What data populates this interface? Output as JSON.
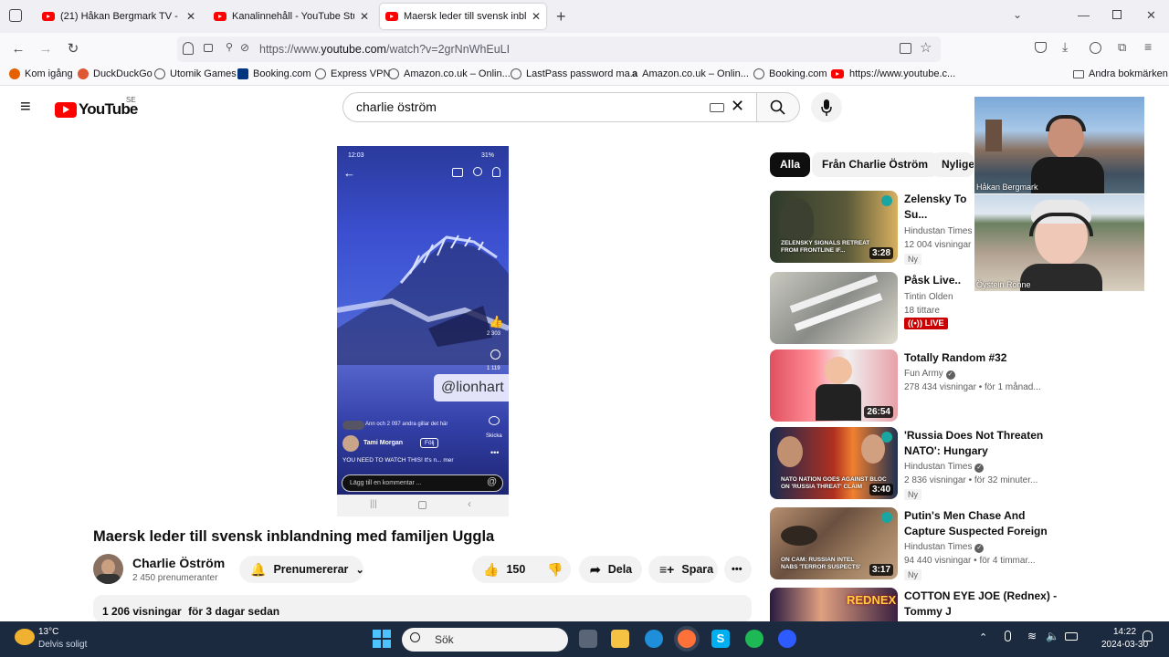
{
  "browser": {
    "tabs": [
      {
        "label": "(21) Håkan Bergmark TV - YouTu",
        "active": false
      },
      {
        "label": "Kanalinnehåll - YouTube Studio",
        "active": false
      },
      {
        "label": "Maersk leder till svensk inblandn",
        "active": true
      }
    ],
    "url_prefix": "https://www.",
    "url_domain": "youtube.com",
    "url_suffix": "/watch?v=2grNnWhEuLI",
    "bookmarks": [
      "Kom igång",
      "DuckDuckGo",
      "Utomik Games",
      "Booking.com",
      "Express VPN",
      "Amazon.co.uk – Onlin...",
      "LastPass password ma...",
      "Amazon.co.uk – Onlin...",
      "Booking.com",
      "https://www.youtube.c..."
    ],
    "other_bookmarks": "Andra bokmärken"
  },
  "youtube": {
    "logo_text": "YouTube",
    "country_code": "SE",
    "search_value": "charlie öström",
    "video": {
      "title": "Maersk leder till svensk inblandning med familjen Uggla",
      "channel": "Charlie Öström",
      "subscribers": "2 450 prenumeranter",
      "subscribe_label": "Prenumererar",
      "likes": "150",
      "share_label": "Dela",
      "save_label": "Spara",
      "views": "1 206 visningar",
      "age": "för 3 dagar sedan"
    },
    "phone": {
      "status_time": "12:03",
      "battery": "31%",
      "watermark": "@lionhart",
      "like_count": "2 303",
      "comment_count": "1 119",
      "liked_by": "Ann och 2 097 andra gillar det här",
      "user": "Tami Morgan",
      "follow": "Följ",
      "caption": "YOU NEED TO WATCH THIS! It's n... mer",
      "comment_placeholder": "Lägg till en kommentar ...",
      "send": "Skicka"
    },
    "chips": [
      "Alla",
      "Från Charlie Öström",
      "Nyligen"
    ],
    "related": [
      {
        "title": "Zelensky To Su... Ukrainian Pres...",
        "channel": "Hindustan Times",
        "meta": "12 004 visningar",
        "badge": "Ny",
        "duration": "3:28",
        "caption": "ZELENSKY SIGNALS RETREAT FROM FRONTLINE IF..."
      },
      {
        "title": "Påsk Live..",
        "channel": "Tintin Olden",
        "meta": "18 tittare",
        "badge": "LIVE",
        "duration": "",
        "caption": ""
      },
      {
        "title": "Totally Random #32",
        "channel": "Fun Army",
        "meta": "278 434 visningar  • för 1 månad...",
        "badge": "",
        "duration": "26:54",
        "caption": ""
      },
      {
        "title": "'Russia Does Not Threaten NATO': Hungary Contradicts...",
        "channel": "Hindustan Times",
        "meta": "2 836 visningar  • för 32 minuter...",
        "badge": "Ny",
        "duration": "3:40",
        "caption": "NATO NATION GOES AGAINST BLOC ON 'RUSSIA THREAT' CLAIM"
      },
      {
        "title": "Putin's Men Chase And Capture Suspected Foreign Terrorists...",
        "channel": "Hindustan Times",
        "meta": "94 440 visningar  • för 4 timmar...",
        "badge": "Ny",
        "duration": "3:17",
        "caption": "ON CAM: RUSSIAN INTEL NABS 'TERROR SUSPECTS'"
      },
      {
        "title": "COTTON EYE JOE (Rednex) - Tommy J",
        "channel": "",
        "meta": "",
        "badge": "",
        "duration": "",
        "caption": "REDNEX"
      }
    ]
  },
  "webcams": [
    {
      "name": "Håkan Bergmark"
    },
    {
      "name": "Öystein Rönne"
    }
  ],
  "taskbar": {
    "weather_temp": "13°C",
    "weather_desc": "Delvis soligt",
    "search_label": "Sök",
    "time": "14:22",
    "date": "2024-03-30"
  },
  "colors": {
    "brand_red": "#ff0000",
    "live_red": "#cc0000",
    "taskbar": "#1c2a40"
  }
}
